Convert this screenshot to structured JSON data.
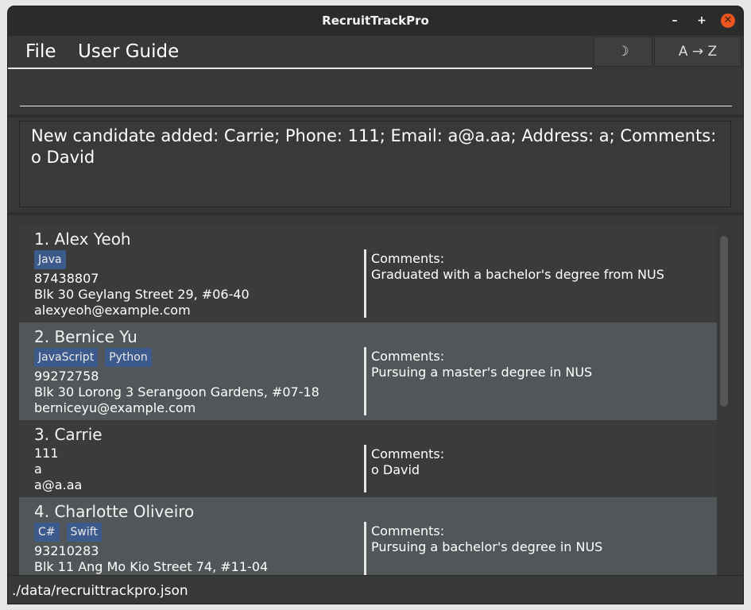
{
  "window": {
    "title": "RecruitTrackPro",
    "min_glyph": "–",
    "max_glyph": "+",
    "close_glyph": "✕"
  },
  "menubar": {
    "file": "File",
    "user_guide": "User Guide",
    "theme_glyph": "☽",
    "sort_label": "A → Z"
  },
  "command": {
    "value": ""
  },
  "result": {
    "text": "New candidate added: Carrie; Phone: 111; Email: a@a.aa; Address: a; Comments: o David"
  },
  "candidates": [
    {
      "name": "1. Alex Yeoh",
      "tags": [
        "Java"
      ],
      "phone": "87438807",
      "address": "Blk 30 Geylang Street 29, #06-40",
      "email": "alexyeoh@example.com",
      "comments_label": "Comments:",
      "comments": "Graduated with a bachelor's degree from NUS"
    },
    {
      "name": "2. Bernice Yu",
      "tags": [
        "JavaScript",
        "Python"
      ],
      "phone": "99272758",
      "address": "Blk 30 Lorong 3 Serangoon Gardens, #07-18",
      "email": "berniceyu@example.com",
      "comments_label": "Comments:",
      "comments": "Pursuing a master's degree in NUS"
    },
    {
      "name": "3. Carrie",
      "tags": [],
      "phone": "111",
      "address": "a",
      "email": "a@a.aa",
      "comments_label": "Comments:",
      "comments": "o David"
    },
    {
      "name": "4. Charlotte Oliveiro",
      "tags": [
        "C#",
        "Swift"
      ],
      "phone": "93210283",
      "address": "Blk 11 Ang Mo Kio Street 74, #11-04",
      "email": "",
      "comments_label": "Comments:",
      "comments": "Pursuing a bachelor's degree in NUS"
    }
  ],
  "status": {
    "path": "./data/recruittrackpro.json"
  },
  "colors": {
    "tag_bg": "#3d5a8c",
    "close_button": "#e95420",
    "row_alt_bg": "#515658"
  },
  "icons": {
    "theme": "moon-icon",
    "sort": "sort-az-icon",
    "close": "close-icon"
  }
}
